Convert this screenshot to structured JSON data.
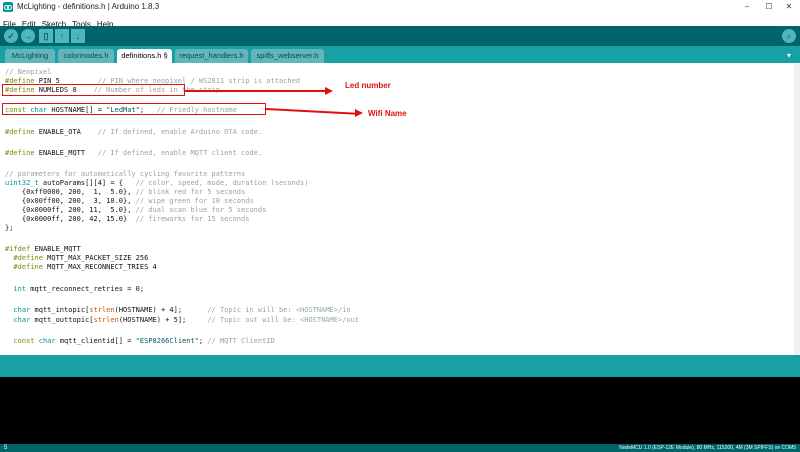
{
  "window": {
    "title": "McLighting - definitions.h | Arduino 1.8.3",
    "minimize": "–",
    "maximize": "☐",
    "close": "✕"
  },
  "menu": [
    "File",
    "Edit",
    "Sketch",
    "Tools",
    "Help"
  ],
  "toolbar": {
    "verify_icon": "✓",
    "upload_icon": "→",
    "new_icon": "▯",
    "open_icon": "↑",
    "save_icon": "↓",
    "serial_icon": "⌕"
  },
  "tabs": [
    {
      "label": "McLighting",
      "active": false
    },
    {
      "label": "colormodes.h",
      "active": false
    },
    {
      "label": "definitions.h §",
      "active": true
    },
    {
      "label": "request_handlers.h",
      "active": false
    },
    {
      "label": "spiffs_webserver.h",
      "active": false
    }
  ],
  "tab_menu_icon": "▾",
  "code": {
    "l1": "// Neopixel",
    "l2_kw": "#define",
    "l2_rest": " PIN 5         ",
    "l2_cm": "// PIN where neopixel / WS2811 strip is attached",
    "l3_kw": "#define",
    "l3_rest": " NUMLEDS 8    ",
    "l3_cm": "// Number of leds in the strip",
    "l5_kw": "const",
    "l5_ty": " char",
    "l5_rest": " HOSTNAME[] = ",
    "l5_st": "\"LedMat\"",
    "l5_rest2": ";   ",
    "l5_cm": "// Friedly hostname",
    "l7_kw": "#define",
    "l7_rest": " ENABLE_OTA    ",
    "l7_cm": "// If defined, enable Arduino OTA code.",
    "l9_kw": "#define",
    "l9_rest": " ENABLE_MQTT   ",
    "l9_cm": "// If defined, enable MQTT client code.",
    "l11": "// parameters for automatically cycling favorite patterns",
    "l12_ty": "uint32_t",
    "l12_rest": " autoParams[][4] = {   ",
    "l12_cm": "// color, speed, mode, duration (seconds)",
    "l13_rest": "    {0xff0000, 200,  1,  5.0}, ",
    "l13_cm": "// blink red for 5 seconds",
    "l14_rest": "    {0x00ff00, 200,  3, 10.0}, ",
    "l14_cm": "// wipe green for 10 seconds",
    "l15_rest": "    {0x0000ff, 200, 11,  5.0}, ",
    "l15_cm": "// dual scan blue for 5 seconds",
    "l16_rest": "    {0x0000ff, 200, 42, 15.0}  ",
    "l16_cm": "// fireworks for 15 seconds",
    "l17": "};",
    "l19_kw": "#ifdef",
    "l19_rest": " ENABLE_MQTT",
    "l20_kw": "  #define",
    "l20_rest": " MQTT_MAX_PACKET_SIZE 256",
    "l21_kw": "  #define",
    "l21_rest": " MQTT_MAX_RECONNECT_TRIES 4",
    "l23_ty": "  int",
    "l23_rest": " mqtt_reconnect_retries = 0;",
    "l25_ty": "  char",
    "l25_rest": " mqtt_intopic[",
    "l25_fn": "strlen",
    "l25_rest2": "(HOSTNAME) + 4];      ",
    "l25_cm": "// Topic in will be: <HOSTNAME>/in",
    "l26_ty": "  char",
    "l26_rest": " mqtt_outtopic[",
    "l26_fn": "strlen",
    "l26_rest2": "(HOSTNAME) + 5];     ",
    "l26_cm": "// Topic out will be: <HOSTNAME>/out",
    "l28_kw": "  const",
    "l28_ty": " char",
    "l28_rest": " mqtt_clientid[] = ",
    "l28_st": "\"ESP8266Client\"",
    "l28_rest2": "; ",
    "l28_cm": "// MQTT ClientID"
  },
  "annotations": {
    "led_number": "Led number",
    "wifi_name": "Wifi Name"
  },
  "status": {
    "line": "5",
    "board": "NodeMCU 1.0 (ESP-12E Module), 80 MHz, 115200, 4M (3M SPIFFS) on COM5"
  },
  "colors": {
    "toolbar": "#006468",
    "tabbar": "#17a1a5",
    "annotation": "#e01010",
    "keyword": "#728e00",
    "type": "#00979c",
    "comment": "#95a5a6"
  }
}
